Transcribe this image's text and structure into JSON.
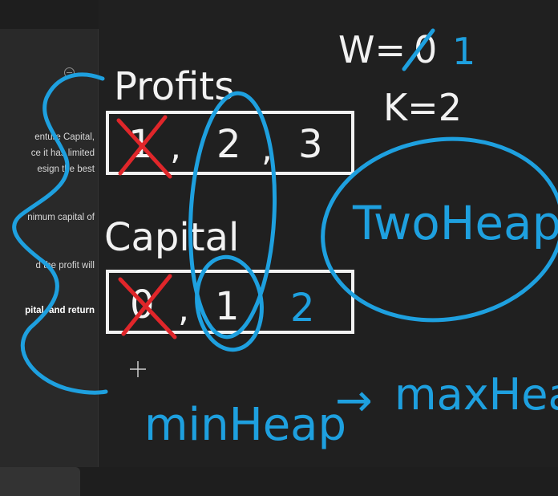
{
  "panel": {
    "lines": [
      "enture Capital,",
      "ce it has limited",
      "esign the best",
      "nimum capital of",
      "d the profit will",
      "pital, and return"
    ]
  },
  "board": {
    "w_label": "W=",
    "w_old": "0",
    "w_new": "1",
    "k_label": "K=2",
    "profits_label": "Profits",
    "profits_values": [
      "1",
      ",",
      "2",
      ",",
      "3"
    ],
    "capital_label": "Capital",
    "capital_values": [
      "0",
      ",",
      "1",
      "2"
    ],
    "two_heap": "TwoHeap",
    "min_heap": "minHeap",
    "arrow": "→",
    "max_heap": "maxHeap"
  },
  "colors": {
    "chalk": "#f2f2f2",
    "marker_blue": "#1ea0df",
    "marker_red": "#e0262a"
  }
}
